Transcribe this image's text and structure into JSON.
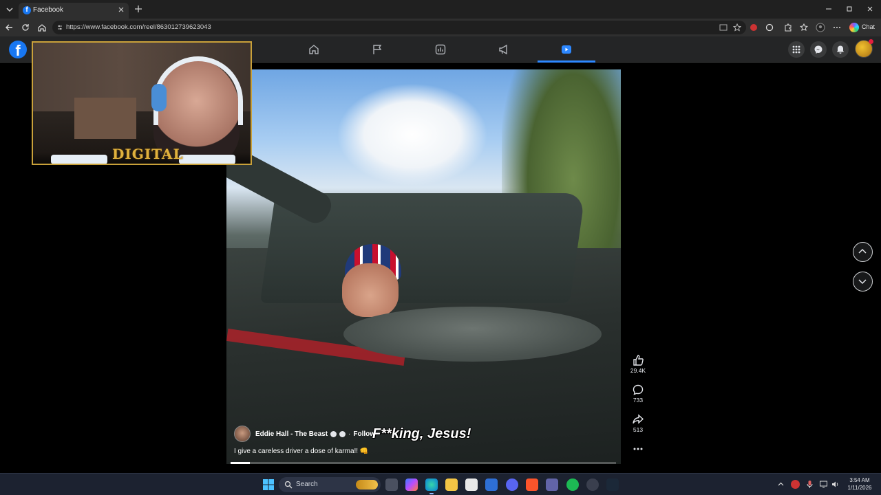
{
  "browser": {
    "tab_title": "Facebook",
    "url": "https://www.facebook.com/reel/863012739623043",
    "chat_label": "Chat"
  },
  "reel": {
    "author": "Eddie Hall - The Beast",
    "separator": "·",
    "follow_label": "Follow",
    "description": "I give a careless driver a dose of karma!! 👊",
    "overlay_caption": "F**king, Jesus!",
    "likes": "29.4K",
    "comments": "733",
    "shares": "513",
    "progress_fraction": 0.05
  },
  "webcam": {
    "brand_text": "DIGITAL"
  },
  "taskbar": {
    "search_placeholder": "Search",
    "time": "3:54 AM",
    "date": "1/11/2026"
  },
  "colors": {
    "facebook_blue": "#1877f2",
    "nav_active": "#2d88ff",
    "webcam_border": "#c9a13a"
  },
  "icons": {
    "nav": [
      "home-icon",
      "flag-icon",
      "marketplace-icon",
      "megaphone-icon",
      "reels-icon"
    ],
    "right": [
      "menu-grid-icon",
      "messenger-icon",
      "bell-icon"
    ]
  }
}
